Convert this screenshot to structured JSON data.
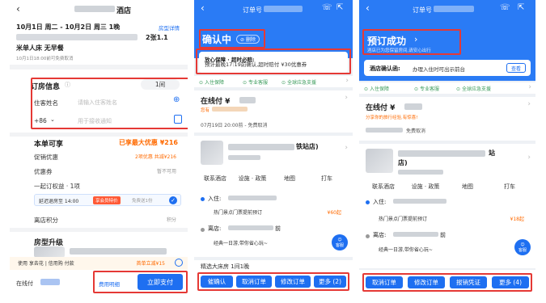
{
  "colors": {
    "brand_blue": "#1e6ff1",
    "highlight_red": "#e53935",
    "price_orange": "#ff6a00"
  },
  "screen1": {
    "hotel_name_suffix": "酒店",
    "dates": "10月1日 周二 - 10月2日 周三  1晚",
    "room_detail_link": "房型详情",
    "room_count_text": "2张1.1",
    "bed_meal": "米单人床  无早餐",
    "free_cancel_note": "10月1日18:00前可免费取消",
    "booking_info_title": "订房信息",
    "room_qty": "1间",
    "guest_name_label": "住客姓名",
    "guest_name_placeholder": "请输入住客姓名",
    "phone_code": "+86",
    "phone_placeholder": "用于接收通知",
    "offers_title": "本单可享",
    "offers_amount": "已享最大优惠 ¥216",
    "promo_label": "促销优惠",
    "promo_value": "2项优惠  共减¥216",
    "coupon_label": "优惠券",
    "coupon_value": "暂不可用",
    "bundle_label": "一起订权益 · 1项",
    "bundle_item": "延迟退房至 14:00",
    "bundle_tag": "享会员特价",
    "bundle_price": "免费送1份",
    "points_label": "离店积分",
    "points_value": "积分",
    "upgrade_title": "房型升级",
    "pay_later_text": "使用  享去花 | 信用购 付款",
    "pay_later_promo": "首单立减¥15",
    "total_label": "在线付",
    "fee_detail": "费用明细",
    "pay_button": "立即支付"
  },
  "screen2": {
    "header_title": "订单号",
    "status": "确认中",
    "delete_label": "删除",
    "notice_title": "放心保障 · 超时必赔:",
    "notice_text": "预计最晚17:19前确认,超时赔付 ¥30优惠券",
    "guarantees": [
      "入住保障",
      "专业客服",
      "全球应急支援"
    ],
    "pay_label": "在线付 ¥",
    "earn_note": "您有",
    "cancel_note": "07月19日 20:00前 - 免费取消",
    "hotel_suffix": "铁站店)",
    "quick_actions": [
      "联系酒店",
      "设施 · 政策",
      "地图",
      "打车"
    ],
    "checkin_label": "入住:",
    "service_item": "热门景点门票提前预订",
    "service_price": "¥60起",
    "checkout_label": "离店:",
    "checkout_suffix": "前",
    "trip_item": "经典一日游,带你省心玩~",
    "assistant_label": "客服",
    "room_row": "精选大床房  1间1晚",
    "actions": [
      "催确认",
      "取消订单",
      "修改订单",
      "更多 (2)"
    ]
  },
  "screen3": {
    "header_title": "订单号",
    "status": "预订成功",
    "status_sub": "酒店已为您保留房间,请安心出行",
    "confirm_label": "酒店确认函:",
    "confirm_text": "办理入住时可出示前台",
    "confirm_button": "查看",
    "guarantees": [
      "入住保障",
      "专业客服",
      "全球应急支援"
    ],
    "pay_label": "在线付 ¥",
    "share_note": "分享你的旅行经验,有惊喜!",
    "cancel_note": "免费取消",
    "hotel_suffix": "站",
    "hotel_suffix2": "店)",
    "quick_actions": [
      "联系酒店",
      "设施 · 政策",
      "地图",
      "打车"
    ],
    "checkin_label": "入住:",
    "service_item": "热门景点门票提前预订",
    "service_price": "¥18起",
    "checkout_label": "离店:",
    "checkout_suffix": "前",
    "trip_item": "经典一日游,带你省心玩~",
    "assistant_label": "客服",
    "actions": [
      "取消订单",
      "修改订单",
      "报销凭证",
      "更多 (4)"
    ]
  }
}
